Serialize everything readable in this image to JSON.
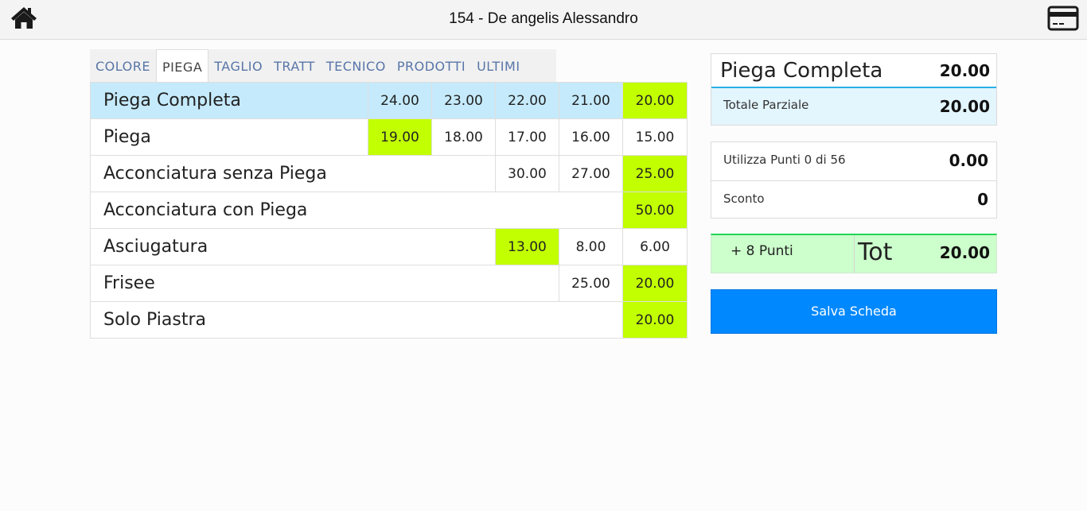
{
  "header": {
    "title": "154 - De angelis Alessandro",
    "home_icon": "home-icon",
    "card_icon": "credit-card-icon"
  },
  "tabs": [
    {
      "label": "COLORE"
    },
    {
      "label": "PIEGA"
    },
    {
      "label": "TAGLIO"
    },
    {
      "label": "TRATT"
    },
    {
      "label": "TECNICO"
    },
    {
      "label": "PRODOTTI"
    },
    {
      "label": "ULTIMI"
    }
  ],
  "active_tab": "PIEGA",
  "services": [
    {
      "name": "Piega Completa",
      "prices": [
        "24.00",
        "23.00",
        "22.00",
        "21.00",
        "20.00"
      ],
      "highlight": 4,
      "selected": true
    },
    {
      "name": "Piega",
      "prices": [
        "19.00",
        "18.00",
        "17.00",
        "16.00",
        "15.00"
      ],
      "highlight": 0,
      "selected": false
    },
    {
      "name": "Acconciatura senza Piega",
      "prices": [
        "30.00",
        "27.00",
        "25.00"
      ],
      "highlight": 2,
      "selected": false
    },
    {
      "name": "Acconciatura con Piega",
      "prices": [
        "50.00"
      ],
      "highlight": 0,
      "selected": false
    },
    {
      "name": "Asciugatura",
      "prices": [
        "13.00",
        "8.00",
        "6.00"
      ],
      "highlight": 0,
      "selected": false
    },
    {
      "name": "Frisee",
      "prices": [
        "25.00",
        "20.00"
      ],
      "highlight": 1,
      "selected": false
    },
    {
      "name": "Solo Piastra",
      "prices": [
        "20.00"
      ],
      "highlight": 0,
      "selected": false
    }
  ],
  "summary": {
    "selected_name": "Piega Completa",
    "selected_price": "20.00",
    "subtotal_label": "Totale Parziale",
    "subtotal": "20.00",
    "points_label": "Utilizza Punti 0 di 56",
    "points_value": "0.00",
    "discount_label": "Sconto",
    "discount_value": "0",
    "earned_points": "+ 8 Punti",
    "total_label": "Tot",
    "total": "20.00",
    "save_label": "Salva Scheda"
  },
  "colors": {
    "accent": "#0088ff",
    "highlight": "#c2ff00",
    "selected_row": "#c5eafb",
    "total_bg": "#ccffcc",
    "tab_text": "#5875a8"
  }
}
